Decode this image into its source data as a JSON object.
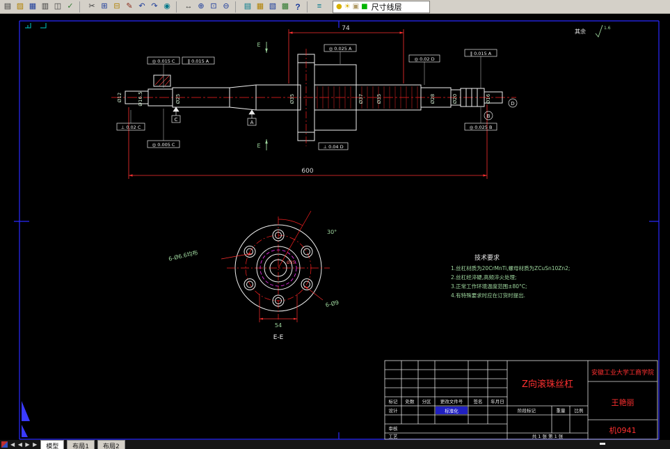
{
  "colors": {
    "canvas_bg": "#000000",
    "geometry_white": "#f0f0f0",
    "dimension_red": "#ff3030",
    "annotation_green": "#9fd89f",
    "frame_blue": "#2a2aff",
    "title_red": "#ff3030",
    "hidden_magenta": "#ff30ff",
    "toolbar_bg": "#d4d0c8"
  },
  "toolbar": {
    "icons": [
      {
        "name": "new-file-icon",
        "glyph": "▤"
      },
      {
        "name": "open-icon",
        "glyph": "▨"
      },
      {
        "name": "save-icon",
        "glyph": "▦"
      },
      {
        "name": "print-icon",
        "glyph": "▥"
      },
      {
        "name": "print-preview-icon",
        "glyph": "◫"
      },
      {
        "name": "spell-check-icon",
        "glyph": "✓"
      },
      {
        "name": "cut-icon",
        "glyph": "✂"
      },
      {
        "name": "copy-icon",
        "glyph": "⊞"
      },
      {
        "name": "paste-icon",
        "glyph": "⊟"
      },
      {
        "name": "match-properties-icon",
        "glyph": "✎"
      },
      {
        "name": "undo-icon",
        "glyph": "↶"
      },
      {
        "name": "redo-icon",
        "glyph": "↷"
      },
      {
        "name": "hyperlink-icon",
        "glyph": "◉"
      },
      {
        "name": "pan-icon",
        "glyph": "↔"
      },
      {
        "name": "zoom-realtime-icon",
        "glyph": "⊕"
      },
      {
        "name": "zoom-window-icon",
        "glyph": "⊡"
      },
      {
        "name": "zoom-previous-icon",
        "glyph": "⊖"
      },
      {
        "name": "properties-icon",
        "glyph": "▤"
      },
      {
        "name": "design-center-icon",
        "glyph": "▦"
      },
      {
        "name": "tool-palettes-icon",
        "glyph": "▧"
      },
      {
        "name": "db-connect-icon",
        "glyph": "▩"
      },
      {
        "name": "help-icon",
        "glyph": "?"
      },
      {
        "name": "layer-manager-icon",
        "glyph": "≡"
      }
    ],
    "layer_panel": {
      "bulb_icon": "●",
      "sun_icon": "☀",
      "lock_icon": "▣",
      "swatch_icon": "■",
      "current_layer": "尺寸线层"
    }
  },
  "drawing": {
    "surface_note": "其余",
    "surface_value": "1.6",
    "dims": {
      "nut_length": "74",
      "overall_length": "600"
    },
    "dia_labels": [
      "Ø12",
      "Ø16.5",
      "Ø25",
      "Ø35",
      "Ø37",
      "Ø35",
      "Ø28",
      "Ø20",
      "Ø16"
    ],
    "gdt": [
      "◎ 0.015 C",
      "∥ 0.015 A",
      "◎ 0.025 A",
      "◎ 0.02 D",
      "∥ 0.015 A",
      "⊥ 0.02 C",
      "◎ 0.005 C",
      "⊥ 0.04 D",
      "◎ 0.025 B"
    ],
    "datums": [
      "C",
      "A",
      "B",
      "D"
    ],
    "section_label": "E",
    "flange": {
      "holes_note": "6-Ø6.6均布",
      "holes_note2": "6-Ø9",
      "bolt_span": "54",
      "angle": "30°",
      "center_dia": "Ø35",
      "section_title": "E-E"
    },
    "tech_req": {
      "title": "技术要求",
      "lines": [
        "1.丝杠材质为20CrMnTi,螺母材质为ZCuSn10Zn2;",
        "2.丝杠经淬硬,高频淬火处理;",
        "3.正常工作环境温度范围±80°C;",
        "4.有特殊要求时应在订货时提出."
      ]
    },
    "title_block": {
      "part_name": "Z向滚珠丝杠",
      "org": "安徽工业大学工商学院",
      "designer": "王艳丽",
      "drawing_no": "机0941",
      "col_headers": [
        "标记",
        "处数",
        "分区",
        "更改文件号",
        "签名",
        "年月日"
      ],
      "row_labels": [
        "设计",
        "标准化",
        "审核",
        "工艺"
      ],
      "stage_label": "阶段标记",
      "weight_label": "重量",
      "scale_label": "比例",
      "sheet_note": "共 1 张  第 1 张"
    }
  },
  "statusbar": {
    "nav_arrows": "◀ ◀ ▶ ▶",
    "tabs": [
      "模型",
      "布局1",
      "布局2"
    ]
  }
}
